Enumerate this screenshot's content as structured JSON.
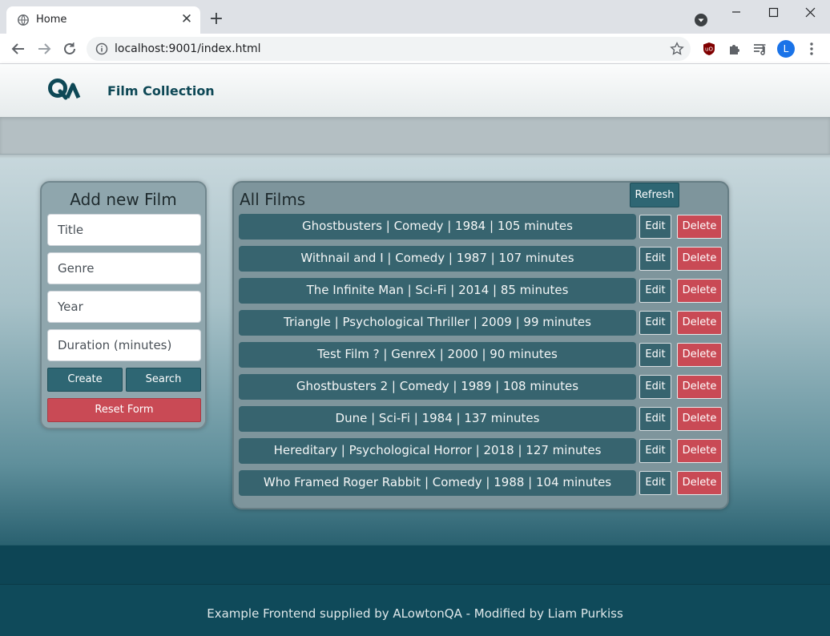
{
  "browser": {
    "tab_title": "Home",
    "tab_close": "✕",
    "new_tab": "+",
    "url": "localhost:9001/index.html",
    "profile_initial": "L"
  },
  "navbar": {
    "brand": "Film Collection"
  },
  "add_form": {
    "title": "Add new Film",
    "title_placeholder": "Title",
    "genre_placeholder": "Genre",
    "year_placeholder": "Year",
    "duration_placeholder": "Duration (minutes)",
    "create_label": "Create",
    "search_label": "Search",
    "reset_label": "Reset Form"
  },
  "film_list": {
    "title": "All Films",
    "refresh_label": "Refresh",
    "edit_label": "Edit",
    "delete_label": "Delete",
    "films": [
      "Ghostbusters | Comedy | 1984 | 105 minutes",
      "Withnail and I | Comedy | 1987 | 107 minutes",
      "The Infinite Man | Sci-Fi | 2014 | 85 minutes",
      "Triangle | Psychological Thriller | 2009 | 99 minutes",
      "Test Film ? | GenreX | 2000 | 90 minutes",
      "Ghostbusters 2 | Comedy | 1989 | 108 minutes",
      "Dune | Sci-Fi | 1984 | 137 minutes",
      "Hereditary | Psychological Horror | 2018 | 127 minutes",
      "Who Framed Roger Rabbit | Comedy | 1988 | 104 minutes"
    ]
  },
  "footer": {
    "text": "Example Frontend supplied by ALowtonQA - Modified by Liam Purkiss"
  },
  "colors": {
    "primary": "#37646f",
    "danger": "#c94a55",
    "footer": "#0f4a5a"
  }
}
